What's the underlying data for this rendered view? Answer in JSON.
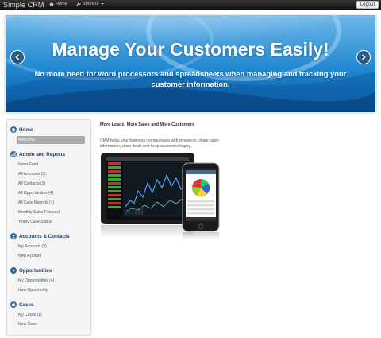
{
  "navbar": {
    "brand": "Simple CRM",
    "home_label": "Home",
    "shortcut_label": "Shortcut",
    "logout_label": "Logout"
  },
  "hero": {
    "title": "Manage Your Customers Easily!",
    "subtitle": "No more need for word processors and spreadsheets when managing and tracking your customer information."
  },
  "sidebar": {
    "sections": [
      {
        "title": "Home",
        "icon": "home-icon",
        "items": [
          {
            "label": "Welcome",
            "active": true
          }
        ]
      },
      {
        "title": "Admin and Reports",
        "icon": "admin-icon",
        "items": [
          {
            "label": "News Feed"
          },
          {
            "label": "All Accounts (3)"
          },
          {
            "label": "All Contacts (3)"
          },
          {
            "label": "All Opportunities (4)"
          },
          {
            "label": "All Case Reports (1)"
          },
          {
            "label": "Monthly Sales Forecast"
          },
          {
            "label": "Yearly Case Status"
          }
        ]
      },
      {
        "title": "Accounts & Contacts",
        "icon": "contacts-icon",
        "items": [
          {
            "label": "My Accounts (2)"
          },
          {
            "label": "New Account"
          }
        ]
      },
      {
        "title": "Opportunities",
        "icon": "opportunities-icon",
        "items": [
          {
            "label": "My Opportunities (4)"
          },
          {
            "label": "New Opportunity"
          }
        ]
      },
      {
        "title": "Cases",
        "icon": "cases-icon",
        "items": [
          {
            "label": "My Cases (1)"
          },
          {
            "label": "New Case"
          }
        ]
      }
    ]
  },
  "content": {
    "heading": "More Leads, More Sales and More Customers",
    "text": "CRM helps your business communicate with prospects, share sales information, close deals and keep customers happy."
  },
  "colors": {
    "navbar": "#1a1a1a",
    "hero_blue": "#1e7fc8",
    "sidebar_heading": "#1f3f6b",
    "active_item": "#a9acae"
  }
}
